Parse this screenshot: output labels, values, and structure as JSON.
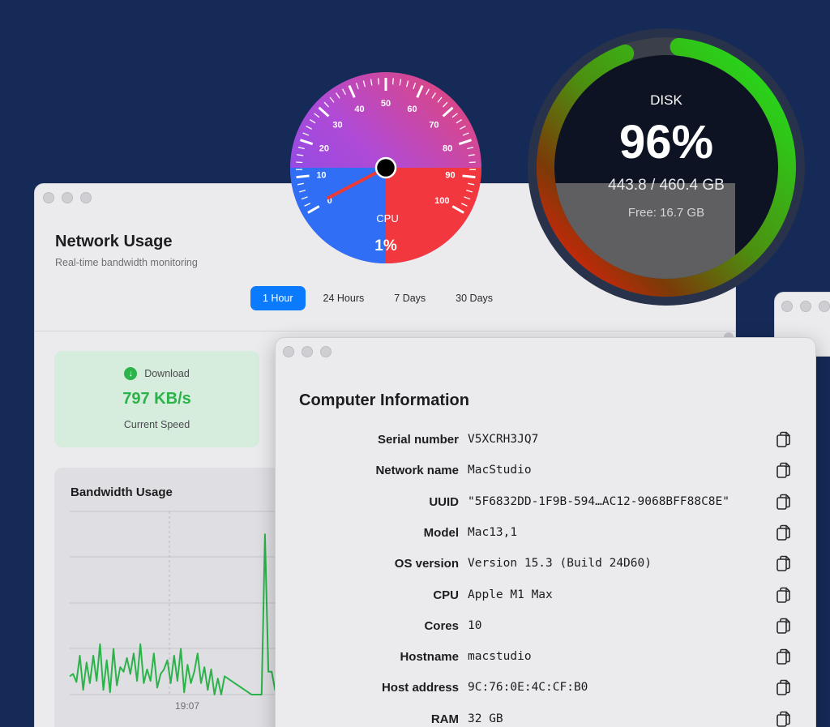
{
  "network": {
    "title": "Network Usage",
    "subtitle": "Real-time bandwidth monitoring",
    "tabs": [
      "1 Hour",
      "24 Hours",
      "7 Days",
      "30 Days"
    ],
    "active_tab": "1 Hour",
    "download": {
      "label": "Download",
      "speed": "797 KB/s",
      "caption": "Current Speed",
      "color": "#2bb34a"
    },
    "bandwidth": {
      "title": "Bandwidth Usage",
      "chart_data": {
        "type": "line",
        "xtick": "19:07",
        "series_color": "#2bb34a",
        "values": [
          0.8,
          0.9,
          0.55,
          1.7,
          0.2,
          1.4,
          0.5,
          1.7,
          0.6,
          2.2,
          0.2,
          1.5,
          0.1,
          2.0,
          0.4,
          1.2,
          1.0,
          1.6,
          0.9,
          1.8,
          0.6,
          2.2,
          0.5,
          1.1,
          0.6,
          1.8,
          0.3,
          0.9,
          1.1,
          1.5,
          0.5,
          1.7,
          0.6,
          2.0,
          0.1,
          1.3,
          0.5,
          1.0,
          1.8,
          0.5,
          1.2,
          0.2,
          1.1,
          0.0,
          0.7,
          0.0,
          0.8,
          0.7,
          0.6,
          0.5,
          0.4,
          0.3,
          0.2,
          0.1,
          0.0,
          0.0,
          0.0,
          0.0,
          7.0,
          1.0,
          1.0,
          0.2,
          0.2,
          0.2,
          0.2,
          0.2
        ]
      }
    }
  },
  "info": {
    "title": "Computer Information",
    "rows": [
      {
        "label": "Serial number",
        "value": "V5XCRH3JQ7"
      },
      {
        "label": "Network name",
        "value": "MacStudio"
      },
      {
        "label": "UUID",
        "value": "\"5F6832DD-1F9B-594…AC12-9068BFF88C8E\""
      },
      {
        "label": "Model",
        "value": "Mac13,1"
      },
      {
        "label": "OS version",
        "value": "Version 15.3 (Build 24D60)"
      },
      {
        "label": "CPU",
        "value": "Apple M1 Max"
      },
      {
        "label": "Cores",
        "value": "10"
      },
      {
        "label": "Hostname",
        "value": "macstudio"
      },
      {
        "label": "Host address",
        "value": "9C:76:0E:4C:CF:B0"
      },
      {
        "label": "RAM",
        "value": "32 GB"
      }
    ]
  },
  "cpu_gauge": {
    "label": "CPU",
    "value_text": "1%",
    "value": 1,
    "ticks": [
      "0",
      "10",
      "20",
      "30",
      "40",
      "50",
      "60",
      "70",
      "80",
      "90",
      "100"
    ]
  },
  "disk_gauge": {
    "label": "DISK",
    "percent_text": "96%",
    "percent": 96,
    "used": "443.8 / 460.4 GB",
    "free": "Free: 16.7 GB"
  }
}
